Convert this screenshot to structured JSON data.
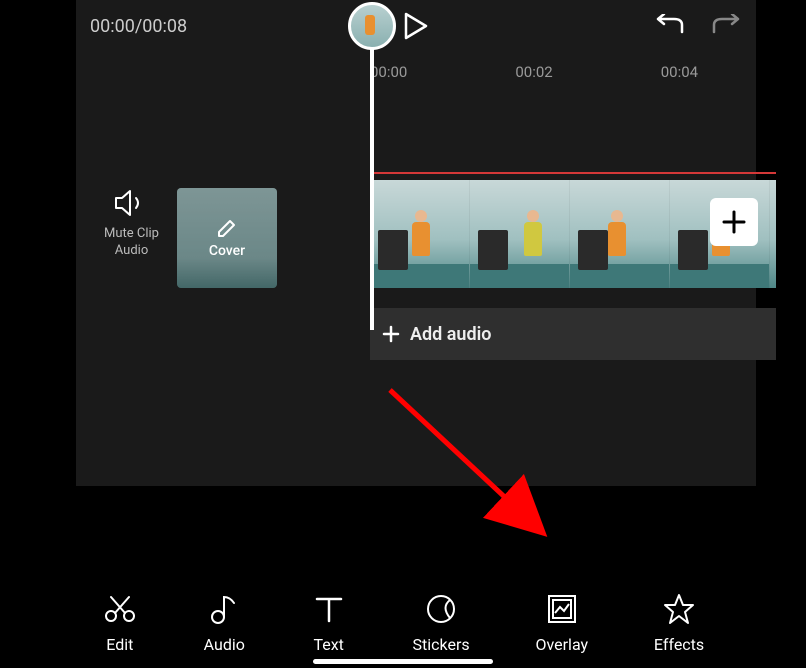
{
  "header": {
    "current_time": "00:00",
    "total_time": "00:08",
    "time_display": "00:00/00:08"
  },
  "ruler": {
    "ticks": [
      "00:00",
      "00:02",
      "00:04"
    ]
  },
  "controls": {
    "mute_label_line1": "Mute Clip",
    "mute_label_line2": "Audio",
    "cover_label": "Cover"
  },
  "tracks": {
    "add_audio_label": "Add audio"
  },
  "toolbar": {
    "items": [
      {
        "name": "edit",
        "label": "Edit"
      },
      {
        "name": "audio",
        "label": "Audio"
      },
      {
        "name": "text",
        "label": "Text"
      },
      {
        "name": "stickers",
        "label": "Stickers"
      },
      {
        "name": "overlay",
        "label": "Overlay"
      },
      {
        "name": "effects",
        "label": "Effects"
      }
    ]
  }
}
